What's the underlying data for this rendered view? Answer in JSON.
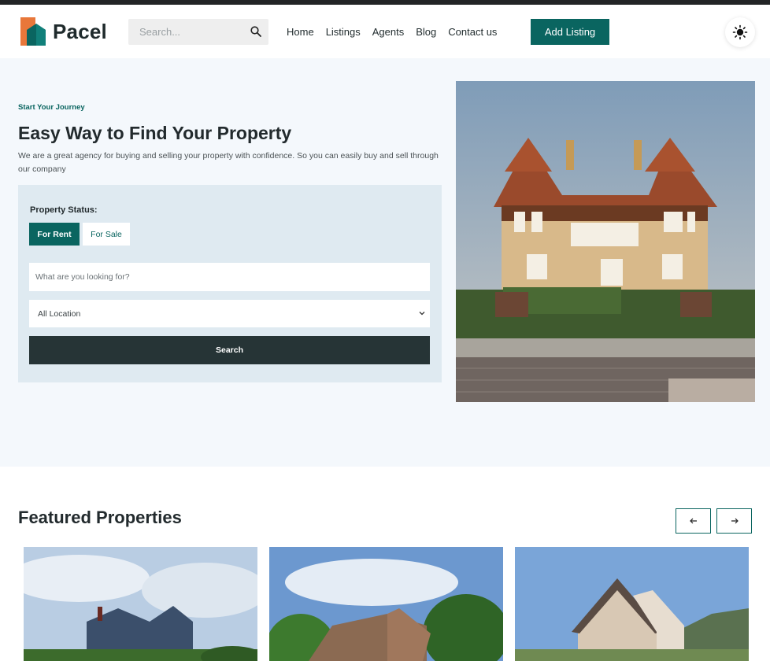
{
  "brand": {
    "name": "Pacel"
  },
  "search": {
    "placeholder": "Search..."
  },
  "nav": {
    "items": [
      "Home",
      "Listings",
      "Agents",
      "Blog",
      "Contact us"
    ]
  },
  "header": {
    "add_listing_label": "Add Listing"
  },
  "hero": {
    "eyebrow": "Start Your Journey",
    "title": "Easy Way to Find Your Property",
    "description": "We are a great agency for buying and selling your property with confidence. So you can easily buy and sell through our company"
  },
  "search_form": {
    "status_label": "Property Status:",
    "tab_rent": "For Rent",
    "tab_sale": "For Sale",
    "looking_placeholder": "What are you looking for?",
    "location_value": "All Location",
    "submit_label": "Search"
  },
  "featured": {
    "title": "Featured Properties"
  },
  "colors": {
    "brand_teal": "#0a6560",
    "dark_button": "#263436",
    "hero_bg": "#f4f8fc",
    "panel_bg": "#dfeaf1"
  },
  "icons": {
    "search": "search-icon",
    "theme": "sun-icon",
    "prev": "arrow-left-icon",
    "next": "arrow-right-icon",
    "select": "chevron-down-icon"
  }
}
